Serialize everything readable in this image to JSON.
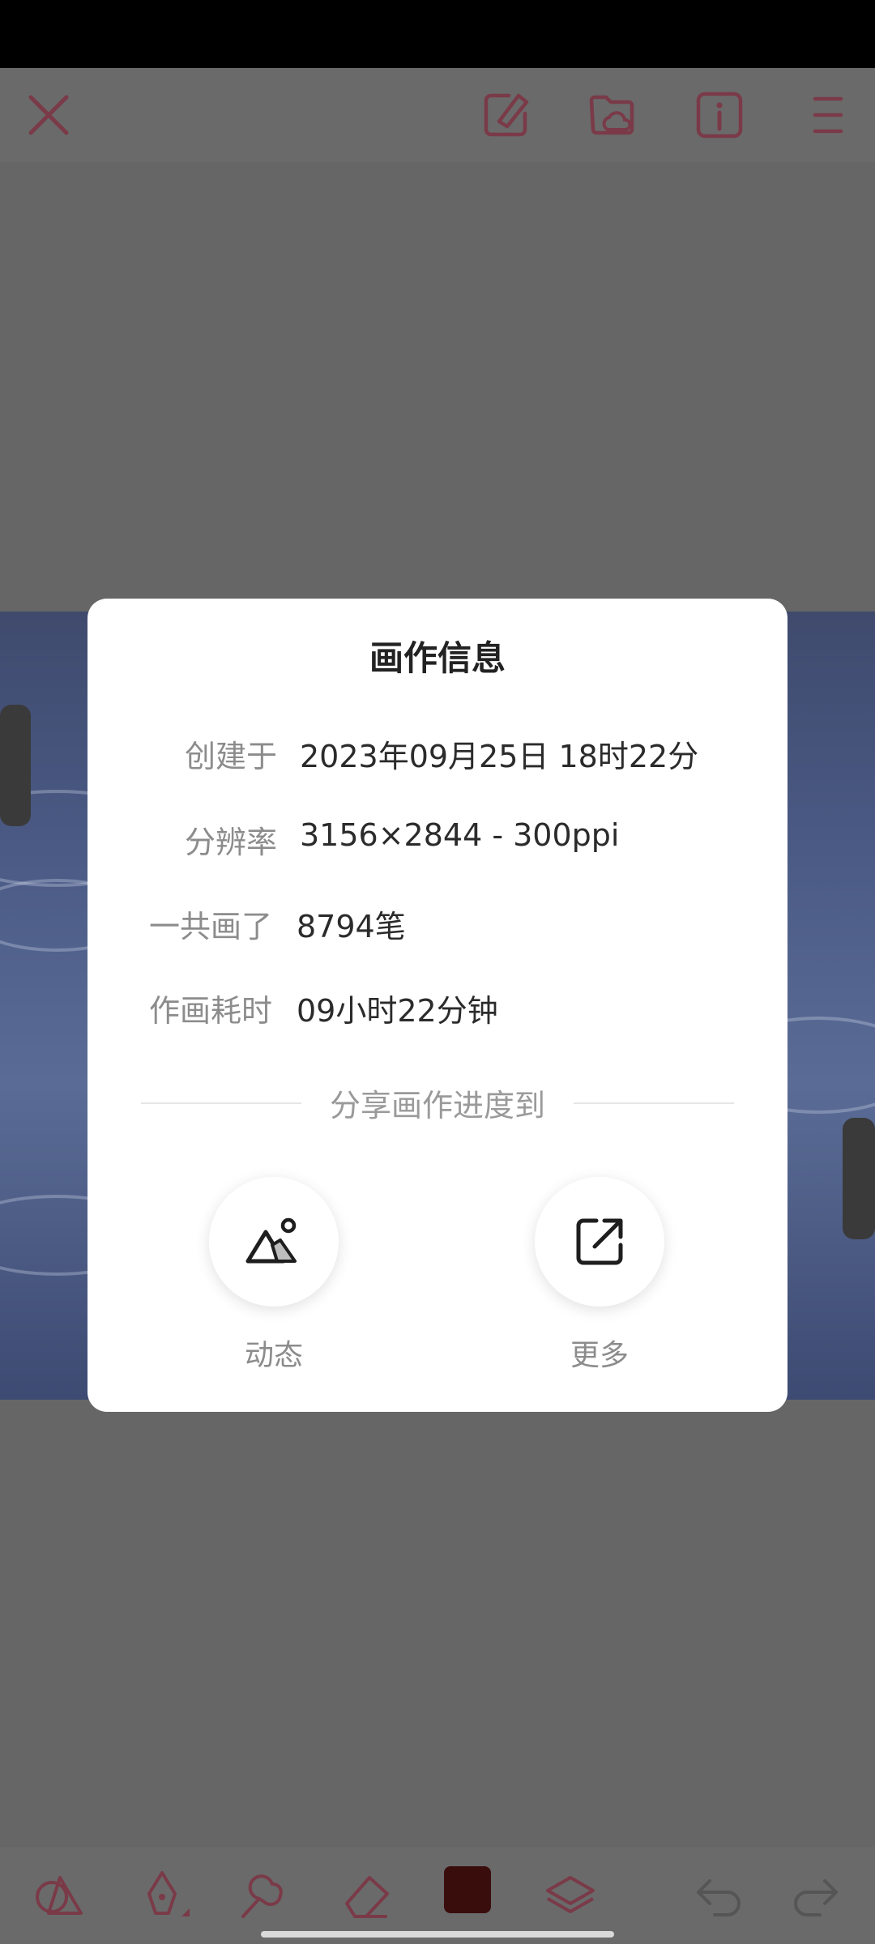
{
  "toolbar": {
    "icons": [
      "close-icon",
      "edit-doc-icon",
      "cloud-folder-icon",
      "info-icon",
      "menu-icon"
    ]
  },
  "bottom_toolbar": {
    "icons": [
      "shapes-icon",
      "pen-icon",
      "smudge-icon",
      "eraser-icon",
      "color-swatch",
      "layers-icon",
      "undo-icon",
      "redo-icon"
    ],
    "current_color": "#3a0d0d"
  },
  "dialog": {
    "title": "画作信息",
    "rows": [
      {
        "label": "创建于",
        "value": "2023年09月25日 18时22分"
      },
      {
        "label": "分辨率",
        "value": "3156×2844 - 300ppi"
      },
      {
        "label": "一共画了",
        "value": "8794笔"
      },
      {
        "label": "作画耗时",
        "value": "09小时22分钟"
      }
    ],
    "share_title": "分享画作进度到",
    "share_options": [
      {
        "label": "动态",
        "icon": "mountain-photo-icon"
      },
      {
        "label": "更多",
        "icon": "external-share-icon"
      }
    ]
  },
  "colors": {
    "accent": "#c2445e",
    "overlay": "#6b6b6b"
  }
}
